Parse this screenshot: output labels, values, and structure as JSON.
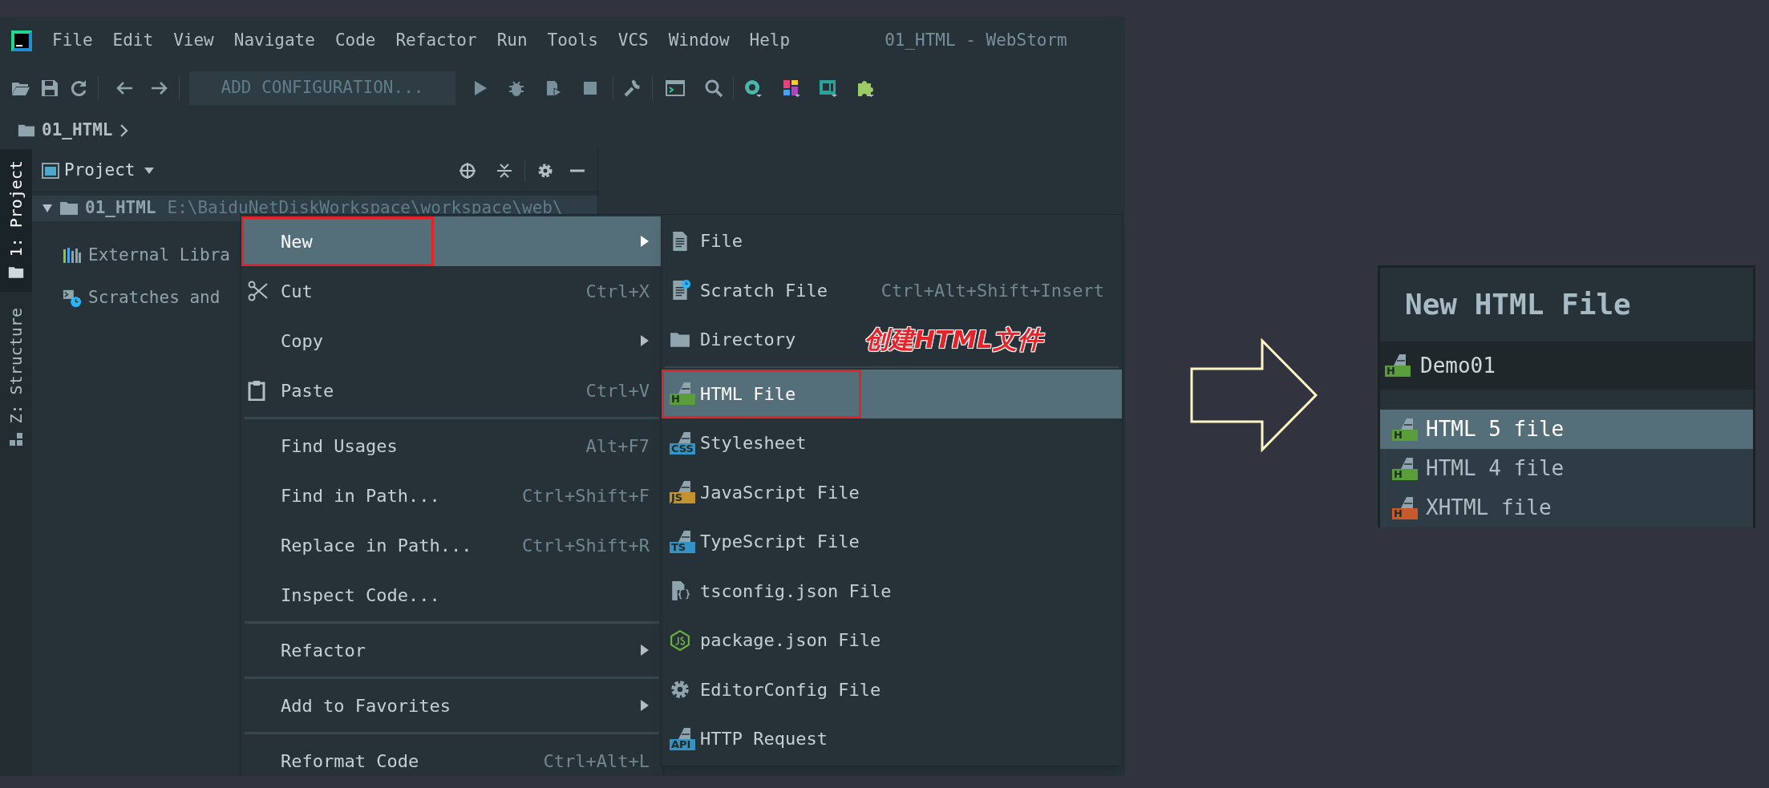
{
  "window": {
    "title": "01_HTML - WebStorm"
  },
  "menu_bar": [
    {
      "label": "File"
    },
    {
      "label": "Edit"
    },
    {
      "label": "View"
    },
    {
      "label": "Navigate"
    },
    {
      "label": "Code"
    },
    {
      "label": "Refactor"
    },
    {
      "label": "Run"
    },
    {
      "label": "Tools"
    },
    {
      "label": "VCS"
    },
    {
      "label": "Window"
    },
    {
      "label": "Help"
    }
  ],
  "toolbar": {
    "configuration_button": "ADD CONFIGURATION..."
  },
  "breadcrumb": [
    "01_HTML"
  ],
  "tool_window_tabs": [
    {
      "label": "1: Project",
      "selected": true
    },
    {
      "label": "Z: Structure",
      "selected": false
    }
  ],
  "project_panel": {
    "title": "Project",
    "tree": [
      {
        "label": "01_HTML",
        "path": "E:\\BaiduNetDiskWorkspace\\workspace\\web\\",
        "kind": "folder",
        "selected": true,
        "expanded": true
      },
      {
        "label": "External Libra",
        "kind": "library",
        "selected": false
      },
      {
        "label": "Scratches and",
        "kind": "scratches",
        "selected": false
      }
    ]
  },
  "context_menu": {
    "items": [
      {
        "kind": "item",
        "label": "New",
        "selected": true,
        "outlined": true,
        "submenu": true
      },
      {
        "kind": "item",
        "label": "Cut",
        "shortcut": "Ctrl+X",
        "selected": false,
        "outlined": false,
        "submenu": false
      },
      {
        "kind": "item",
        "label": "Copy",
        "selected": false,
        "outlined": false,
        "submenu": true
      },
      {
        "kind": "item",
        "label": "Paste",
        "shortcut": "Ctrl+V",
        "selected": false,
        "outlined": false,
        "submenu": false
      },
      {
        "kind": "separator"
      },
      {
        "kind": "item",
        "label": "Find Usages",
        "shortcut": "Alt+F7",
        "selected": false,
        "outlined": false,
        "submenu": false
      },
      {
        "kind": "item",
        "label": "Find in Path...",
        "shortcut": "Ctrl+Shift+F",
        "selected": false,
        "outlined": false,
        "submenu": false
      },
      {
        "kind": "item",
        "label": "Replace in Path...",
        "shortcut": "Ctrl+Shift+R",
        "selected": false,
        "outlined": false,
        "submenu": false
      },
      {
        "kind": "item",
        "label": "Inspect Code...",
        "selected": false,
        "outlined": false,
        "submenu": false
      },
      {
        "kind": "separator"
      },
      {
        "kind": "item",
        "label": "Refactor",
        "selected": false,
        "outlined": false,
        "submenu": true
      },
      {
        "kind": "separator"
      },
      {
        "kind": "item",
        "label": "Add to Favorites",
        "selected": false,
        "outlined": false,
        "submenu": true
      },
      {
        "kind": "separator"
      },
      {
        "kind": "item",
        "label": "Reformat Code",
        "shortcut": "Ctrl+Alt+L",
        "selected": false,
        "outlined": false,
        "submenu": false
      }
    ]
  },
  "submenu": {
    "items": [
      {
        "kind": "item",
        "label": "File",
        "selected": false,
        "outlined": false
      },
      {
        "kind": "item",
        "label": "Scratch File",
        "shortcut": "Ctrl+Alt+Shift+Insert",
        "selected": false,
        "outlined": false
      },
      {
        "kind": "item",
        "label": "Directory",
        "selected": false,
        "outlined": false
      },
      {
        "kind": "separator"
      },
      {
        "kind": "item",
        "label": "HTML File",
        "badge": "H",
        "color": "#5a9e3c",
        "selected": true,
        "outlined": true
      },
      {
        "kind": "item",
        "label": "Stylesheet",
        "badge": "CSS",
        "color": "#3592c4",
        "selected": false,
        "outlined": false
      },
      {
        "kind": "item",
        "label": "JavaScript File",
        "badge": "JS",
        "color": "#c4922f",
        "selected": false,
        "outlined": false
      },
      {
        "kind": "item",
        "label": "TypeScript File",
        "badge": "TS",
        "color": "#3592c4",
        "selected": false,
        "outlined": false
      },
      {
        "kind": "item",
        "label": "tsconfig.json File",
        "selected": false,
        "outlined": false
      },
      {
        "kind": "item",
        "label": "package.json File",
        "selected": false,
        "outlined": false
      },
      {
        "kind": "item",
        "label": "EditorConfig File",
        "selected": false,
        "outlined": false
      },
      {
        "kind": "item",
        "label": "HTTP Request",
        "badge": "API",
        "color": "#3592c4",
        "selected": false,
        "outlined": false
      }
    ]
  },
  "annotation": {
    "text": "创建HTML文件"
  },
  "dialog": {
    "title": "New HTML File",
    "name_field": {
      "value": "Demo01",
      "badge": "H",
      "color": "#5a9e3c"
    },
    "templates": [
      {
        "label": "HTML 5 file",
        "badge": "H",
        "color": "#5a9e3c",
        "selected": true
      },
      {
        "label": "HTML 4 file",
        "badge": "H",
        "color": "#5a9e3c",
        "selected": false
      },
      {
        "label": "XHTML file",
        "badge": "H",
        "color": "#c65a2a",
        "selected": false
      }
    ]
  }
}
